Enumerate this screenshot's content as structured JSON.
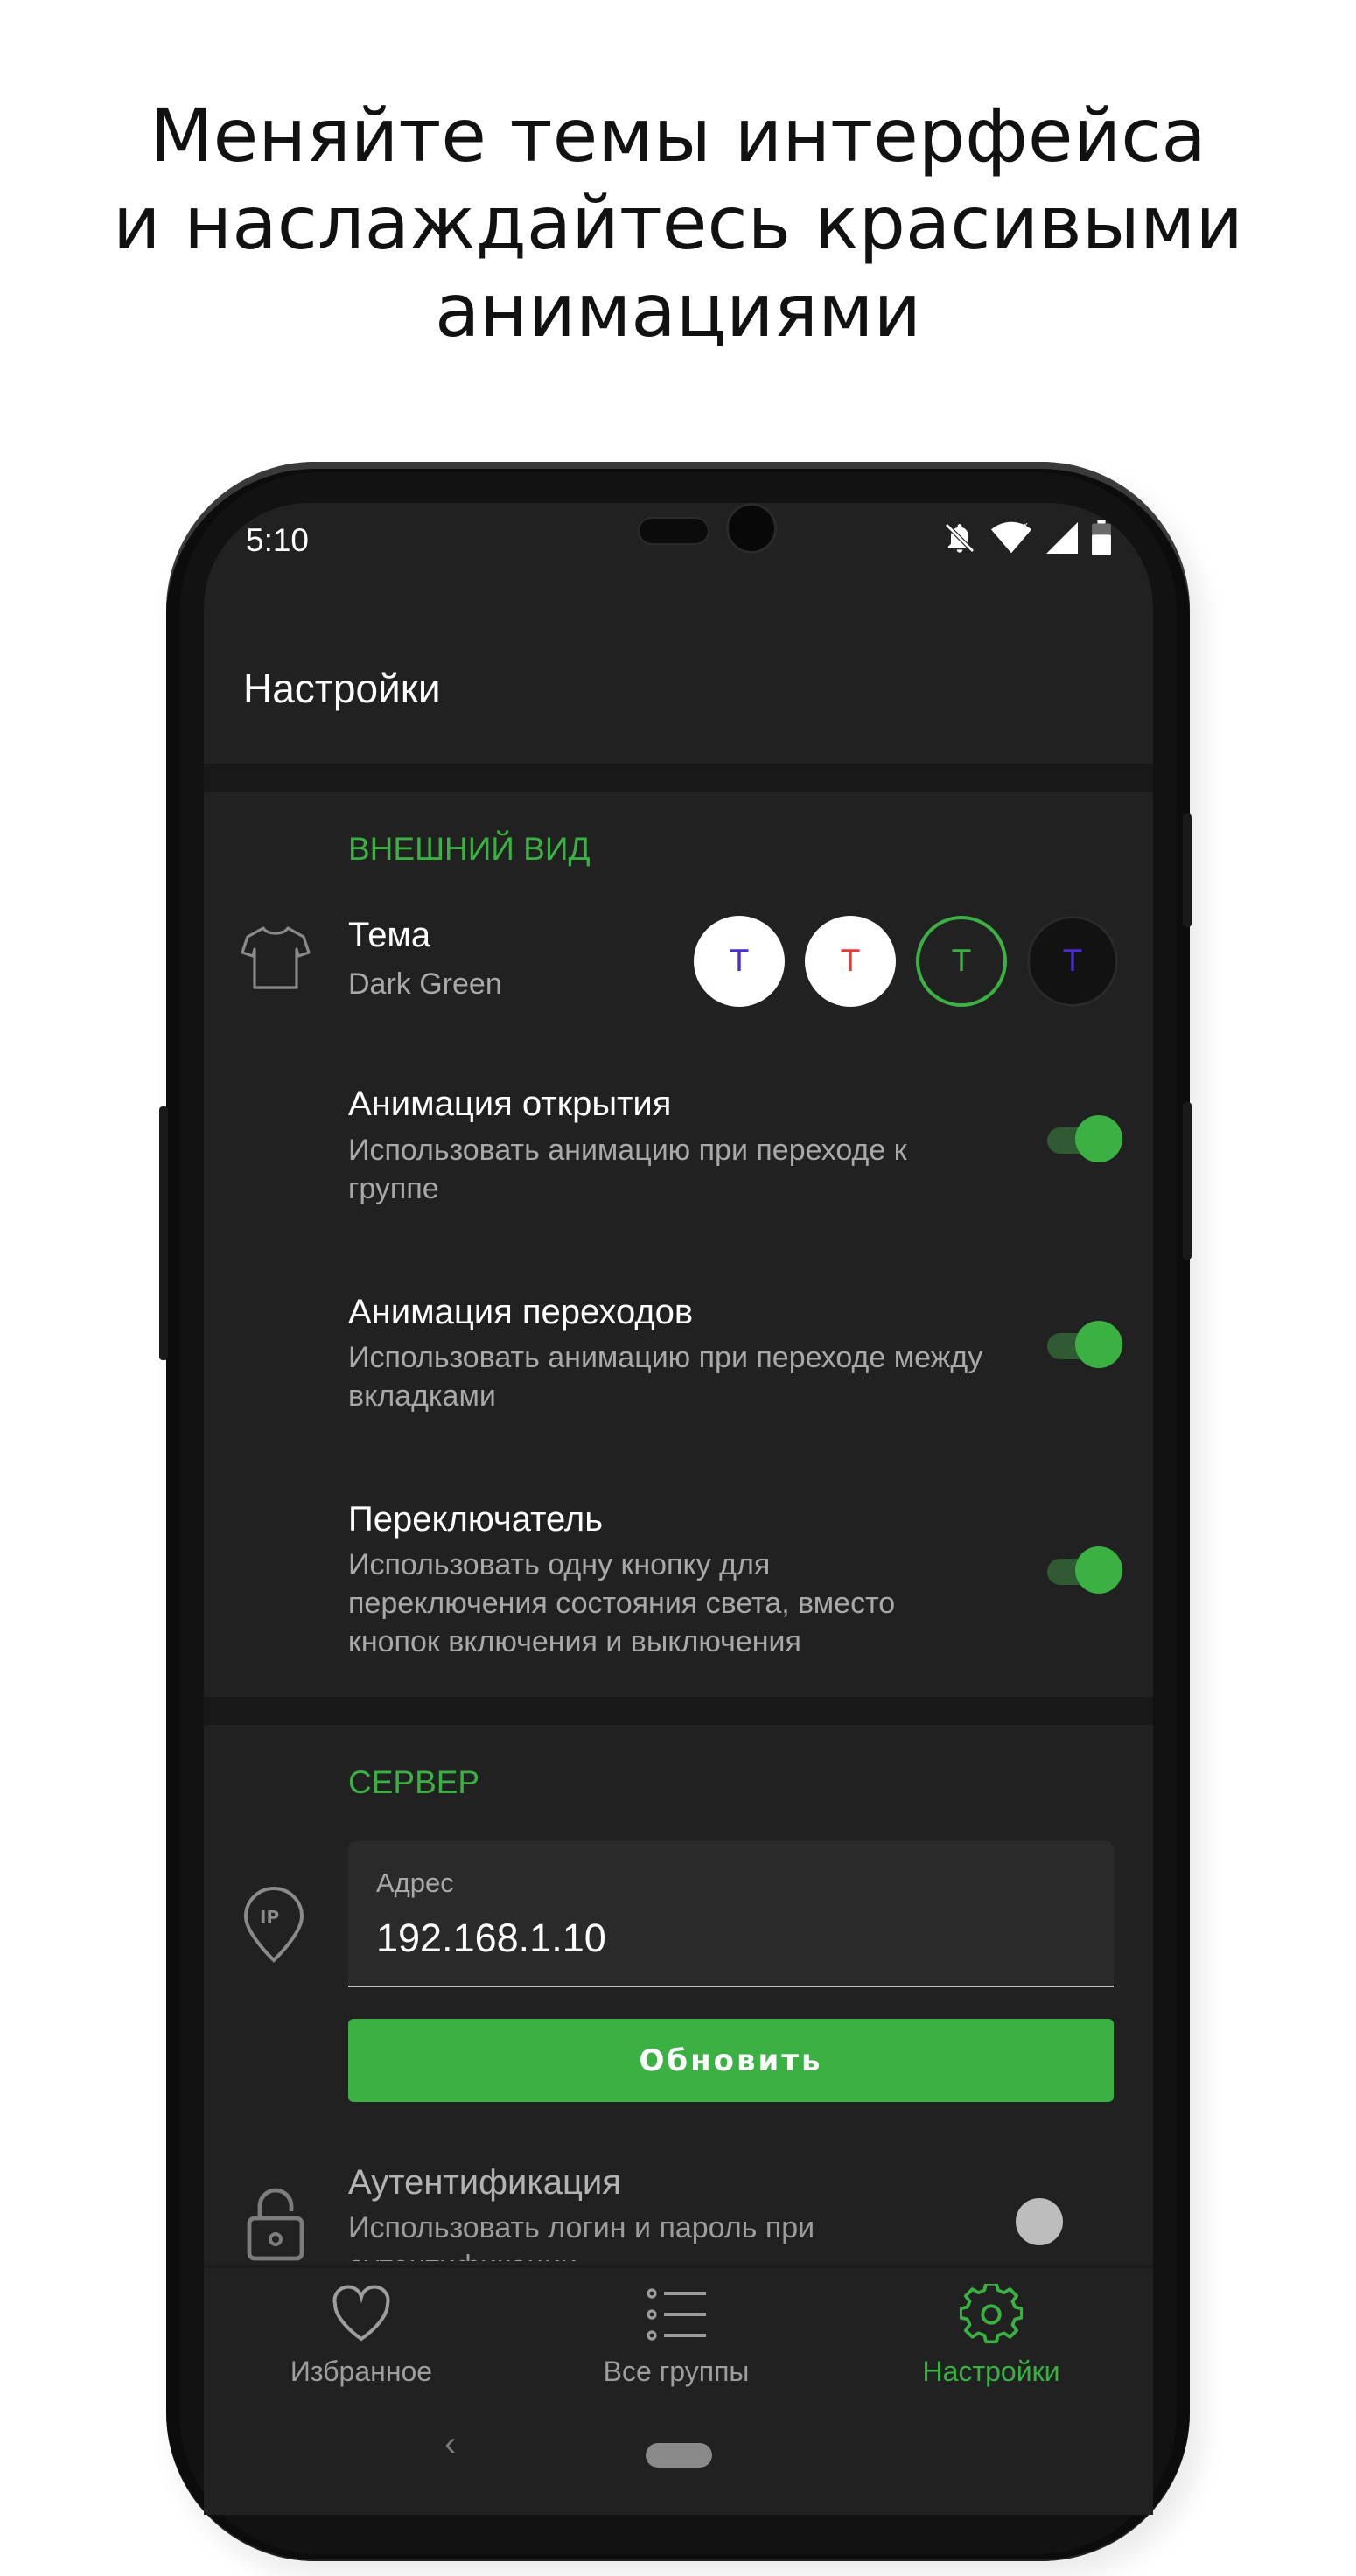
{
  "headline": {
    "line1": "Меняйте темы интерфейса",
    "line2": "и наслаждайтесь красивыми",
    "line3": "анимациями"
  },
  "status_bar": {
    "time": "5:10",
    "icons": [
      "bell-off-icon",
      "wifi-icon",
      "signal-icon",
      "battery-icon"
    ]
  },
  "app_bar": {
    "title": "Настройки"
  },
  "appearance": {
    "section_title": "ВНЕШНИЙ ВИД",
    "theme": {
      "icon": "tshirt-icon",
      "title": "Тема",
      "value": "Dark Green",
      "swatches": [
        {
          "letter": "T",
          "background": "#ffffff",
          "color": "#4a2bd6",
          "selected": false
        },
        {
          "letter": "T",
          "background": "#ffffff",
          "color": "#e53935",
          "selected": false
        },
        {
          "letter": "T",
          "background": "#212121",
          "color": "#3bb143",
          "selected": true
        },
        {
          "letter": "T",
          "background": "#121212",
          "color": "#4a2bd6",
          "selected": false
        }
      ]
    },
    "open_animation": {
      "title": "Анимация открытия",
      "subtitle": "Использовать анимацию при переходе к группе",
      "enabled": true
    },
    "transition_animation": {
      "title": "Анимация переходов",
      "subtitle": "Использовать анимацию при переходе между вкладками",
      "enabled": true
    },
    "toggle_switch": {
      "title": "Переключатель",
      "subtitle": "Использовать одну кнопку для переключения состояния света, вместо кнопок включения и выключения",
      "enabled": true
    }
  },
  "server": {
    "section_title": "СЕРВЕР",
    "address_icon": "ip-pin-icon",
    "address_label": "Адрес",
    "address_value": "192.168.1.10",
    "update_button": "Обновить",
    "auth": {
      "icon": "lock-icon",
      "title": "Аутентификация",
      "subtitle": "Использовать логин и пароль при аутентификации",
      "enabled": false
    }
  },
  "bottom_nav": [
    {
      "label": "Избранное",
      "icon": "heart-icon",
      "active": false
    },
    {
      "label": "Все группы",
      "icon": "list-icon",
      "active": false
    },
    {
      "label": "Настройки",
      "icon": "gear-icon",
      "active": true
    }
  ],
  "colors": {
    "accent": "#3bb143",
    "screen_bg": "#212121",
    "divider": "#181818",
    "text_primary": "#ffffff",
    "text_secondary": "#a9a9a9"
  }
}
